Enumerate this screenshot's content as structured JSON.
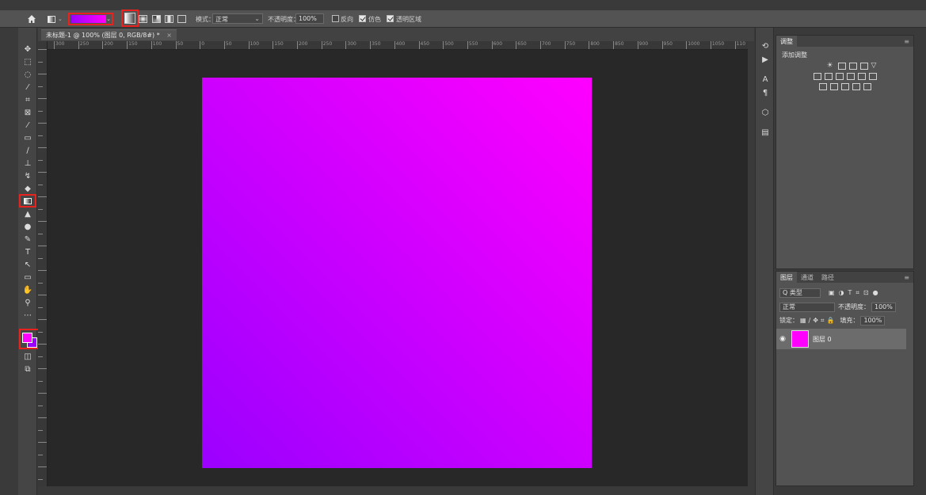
{
  "options_bar": {
    "mode_label": "模式：",
    "mode_value": "正常",
    "opacity_label": "不透明度：",
    "opacity_value": "100%",
    "reverse_label": "反向",
    "dither_label": "仿色",
    "transparency_label": "透明区域",
    "gradient_start_color": "#9b00ff",
    "gradient_end_color": "#ff00ff"
  },
  "document": {
    "tab_title": "未标题-1 @ 100% (图层 0, RGB/8#) *",
    "close_glyph": "×",
    "artboard_gradient": [
      "#9b00ff",
      "#ff00ff"
    ]
  },
  "ruler": {
    "h_labels": [
      "300",
      "250",
      "200",
      "150",
      "100",
      "50",
      "0",
      "50",
      "100",
      "150",
      "200",
      "250",
      "300",
      "350",
      "400",
      "450",
      "500",
      "550",
      "600",
      "650",
      "700",
      "750",
      "800",
      "850",
      "900",
      "950",
      "1000",
      "1050",
      "110"
    ]
  },
  "toolbar": {
    "foreground_color": "#ff00ff",
    "background_color": "#9b00ff",
    "tools": [
      "move-icon",
      "marquee-icon",
      "lasso-icon",
      "magic-wand-icon",
      "crop-icon",
      "frame-icon",
      "eyedropper-icon",
      "healing-icon",
      "brush-icon",
      "stamp-icon",
      "history-brush-icon",
      "eraser-icon",
      "gradient-icon",
      "blur-icon",
      "dodge-icon",
      "pen-icon",
      "type-icon",
      "path-select-icon",
      "shape-icon",
      "hand-icon",
      "zoom-icon",
      "more-icon"
    ]
  },
  "adjustments_panel": {
    "tab": "调整",
    "title": "添加调整"
  },
  "layers_panel": {
    "tabs": [
      "图层",
      "通道",
      "路径"
    ],
    "filter_label": "Q 类型",
    "blend_mode": "正常",
    "opacity_label": "不透明度：",
    "opacity_value": "100%",
    "lock_label": "锁定：",
    "fill_label": "填充：",
    "fill_value": "100%",
    "layer_name": "图层 0",
    "layer_color": "#ff00ff"
  }
}
